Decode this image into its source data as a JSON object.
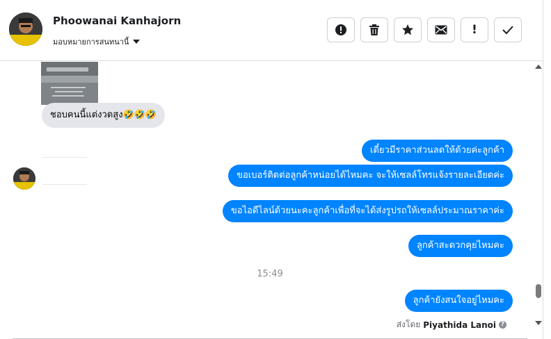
{
  "header": {
    "contact_name": "Phoowanai Kanhajorn",
    "assign_label": "มอบหมายการสนทนานี้",
    "toolbar": {
      "icons": [
        "alert-circle-icon",
        "trash-icon",
        "star-icon",
        "envelope-icon",
        "exclamation-icon",
        "check-icon"
      ],
      "exclaim_glyph": "!"
    }
  },
  "chat": {
    "incoming": {
      "text": "ชอบคนนี้แต่งวดสูง🤣🤣🤣"
    },
    "outgoing": [
      {
        "text": "เดี๋ยวมีราคาส่วนลดให้ด้วยค่ะลูกค้า"
      },
      {
        "text": "ขอเบอร์ติดต่อลูกค้าหน่อยได้ไหมคะ จะให้เซลล์โทรแจ้งรายละเอียดค่ะ"
      },
      {
        "text": "ขอไอดีไลน์ด้วยนะคะลูกค้าเพื่อที่จะได้ส่งรูปรถให้เซลล์ประมาณราคาค่ะ"
      },
      {
        "text": "ลูกค้าสะดวกคุยไหมคะ"
      }
    ],
    "timestamp": "15:49",
    "last_outgoing": {
      "text": "ลูกค้ายังสนใจอยู่ไหมคะ"
    },
    "sent_by_label": "ส่งโดย",
    "sent_by_name": "Piyathida Lanoi",
    "help_glyph": "?"
  },
  "colors": {
    "accent": "#0084ff",
    "incoming_bubble": "#e4e6eb",
    "border": "#ccd0d5"
  }
}
